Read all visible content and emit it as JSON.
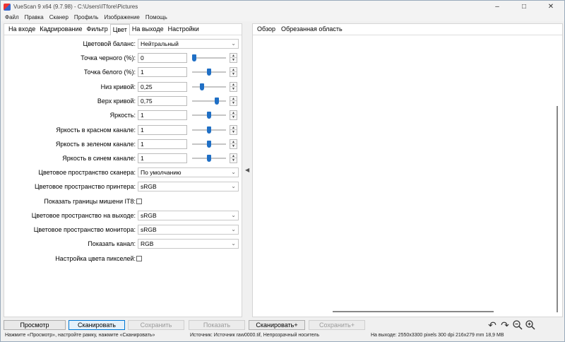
{
  "window": {
    "title": "VueScan 9 x64 (9.7.98) - C:\\Users\\ITfore\\Pictures",
    "controls": [
      "–",
      "□",
      "✕"
    ]
  },
  "menu": [
    "Файл",
    "Правка",
    "Сканер",
    "Профиль",
    "Изображение",
    "Помощь"
  ],
  "left_tabs": [
    {
      "label": "На входе"
    },
    {
      "label": "Кадрирование"
    },
    {
      "label": "Фильтр"
    },
    {
      "label": "Цвет",
      "active": true
    },
    {
      "label": "На выходе"
    },
    {
      "label": "Настройки"
    }
  ],
  "right_tabs": [
    {
      "label": "Обзор",
      "active": true
    },
    {
      "label": "Обрезанная область"
    }
  ],
  "settings": {
    "color_balance": {
      "label": "Цветовой баланс:",
      "value": "Нейтральный"
    },
    "black_point": {
      "label": "Точка черного (%):",
      "value": "0",
      "level": 0.0
    },
    "white_point": {
      "label": "Точка белого (%):",
      "value": "1",
      "level": 0.5
    },
    "curve_low": {
      "label": "Низ кривой:",
      "value": "0,25",
      "level": 0.25
    },
    "curve_high": {
      "label": "Верх кривой:",
      "value": "0,75",
      "level": 0.75
    },
    "brightness": {
      "label": "Яркость:",
      "value": "1",
      "level": 0.5
    },
    "red_brightness": {
      "label": "Яркость в красном канале:",
      "value": "1",
      "level": 0.5
    },
    "green_brightness": {
      "label": "Яркость в зеленом канале:",
      "value": "1",
      "level": 0.5
    },
    "blue_brightness": {
      "label": "Яркость в синем канале:",
      "value": "1",
      "level": 0.5
    },
    "scanner_colorspace": {
      "label": "Цветовое пространство сканера:",
      "value": "По умолчанию"
    },
    "printer_colorspace": {
      "label": "Цветовое пространство принтера:",
      "value": "sRGB"
    },
    "show_it8": {
      "label": "Показать границы мишени IT8:",
      "checked": false
    },
    "output_colorspace": {
      "label": "Цветовое пространство на выходе:",
      "value": "sRGB"
    },
    "monitor_colorspace": {
      "label": "Цветовое пространство монитора:",
      "value": "sRGB"
    },
    "show_channel": {
      "label": "Показать канал:",
      "value": "RGB"
    },
    "pixel_color": {
      "label": "Настройка цвета пикселей:",
      "checked": false
    }
  },
  "buttons": {
    "preview": "Просмотр",
    "scan": "Сканировать",
    "save": "Сохранить",
    "show": "Показать",
    "scan_plus": "Сканировать+",
    "save_plus": "Сохранить+"
  },
  "tools": [
    "rotate-left-icon",
    "rotate-right-icon",
    "zoom-out-icon",
    "zoom-in-icon"
  ],
  "status": {
    "hint": "Нажмите «Просмотр», настройте рамку, нажмите «Сканировать»",
    "source": "Источник: Источник raw0000.tif, Непрозрачный носитель",
    "output": "На выходе: 2550x3300 pixels 300 dpi 216x279 mm 18,9 MB"
  },
  "colors": {
    "accent": "#1f6fc5",
    "primary_border": "#0078d4"
  }
}
